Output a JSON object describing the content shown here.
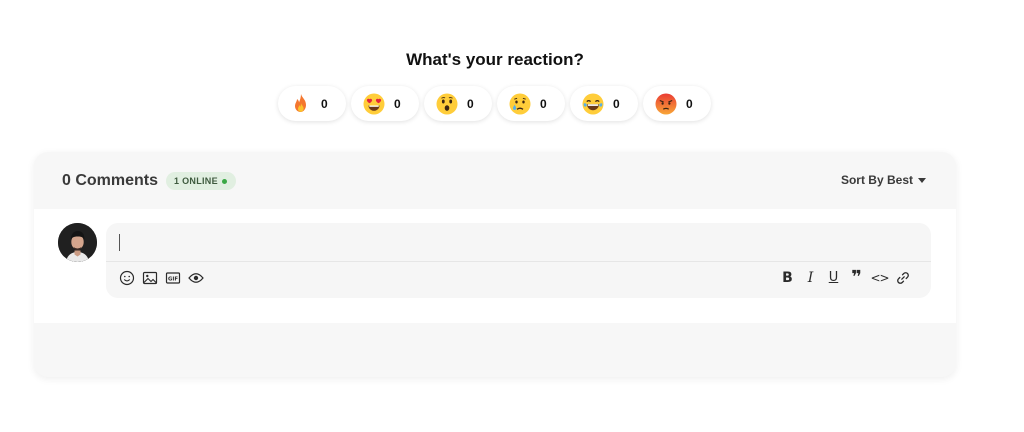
{
  "reactions_section": {
    "title": "What's your reaction?",
    "items": [
      {
        "name": "fire",
        "icon": "fire-emoji-icon",
        "count": "0"
      },
      {
        "name": "love",
        "icon": "heart-eyes-emoji-icon",
        "count": "0"
      },
      {
        "name": "wow",
        "icon": "astonished-emoji-icon",
        "count": "0"
      },
      {
        "name": "sad",
        "icon": "crying-emoji-icon",
        "count": "0"
      },
      {
        "name": "laugh",
        "icon": "laughing-tears-emoji-icon",
        "count": "0"
      },
      {
        "name": "angry",
        "icon": "angry-emoji-icon",
        "count": "0"
      }
    ]
  },
  "comments": {
    "count_label": "0 Comments",
    "online_badge": "1 ONLINE",
    "sort_label": "Sort By Best",
    "online_dot_color": "#3aa845"
  },
  "editor": {
    "left_tools": [
      "emoji-icon",
      "image-icon",
      "gif-icon",
      "preview-eye-icon"
    ],
    "right_tools": [
      "bold-icon",
      "italic-icon",
      "underline-icon",
      "quote-icon",
      "code-icon",
      "link-icon"
    ],
    "bold_glyph": "B",
    "italic_glyph": "I",
    "underline_glyph": "U",
    "quote_glyph": "❞",
    "code_glyph": "<>"
  }
}
